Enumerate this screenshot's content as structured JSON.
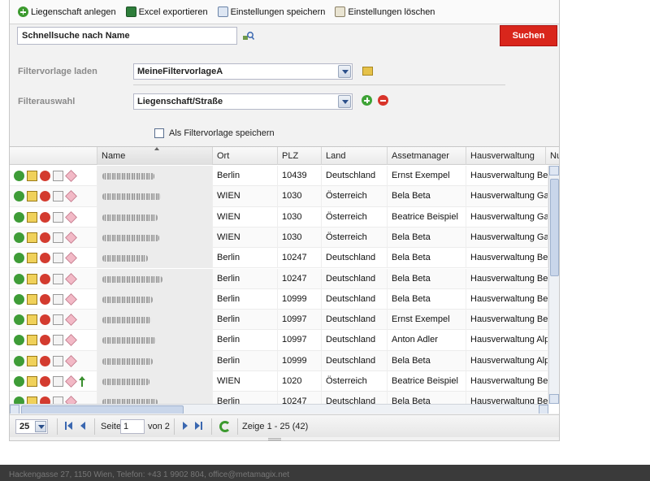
{
  "toolbar": {
    "add_label": "Liegenschaft anlegen",
    "excel_label": "Excel exportieren",
    "save_label": "Einstellungen speichern",
    "delete_label": "Einstellungen löschen"
  },
  "search": {
    "value": "Schnellsuche nach Name",
    "button_label": "Suchen"
  },
  "filter": {
    "template_label": "Filtervorlage laden",
    "template_value": "MeineFiltervorlageA",
    "selection_label": "Filterauswahl",
    "selection_value": "Liegenschaft/Straße",
    "save_checkbox_label": "Als Filtervorlage speichern"
  },
  "grid": {
    "columns": [
      "Name",
      "Ort",
      "PLZ",
      "Land",
      "Assetmanager",
      "Hausverwaltung",
      "Nu"
    ],
    "rows": [
      {
        "ort": "Berlin",
        "plz": "10439",
        "land": "Deutschland",
        "am": "Ernst Exempel",
        "hv": "Hausverwaltung Beta"
      },
      {
        "ort": "WIEN",
        "plz": "1030",
        "land": "Österreich",
        "am": "Bela Beta",
        "hv": "Hausverwaltung Gam"
      },
      {
        "ort": "WIEN",
        "plz": "1030",
        "land": "Österreich",
        "am": "Beatrice Beispiel",
        "hv": "Hausverwaltung Gam"
      },
      {
        "ort": "WIEN",
        "plz": "1030",
        "land": "Österreich",
        "am": "Bela Beta",
        "hv": "Hausverwaltung Gam"
      },
      {
        "ort": "Berlin",
        "plz": "10247",
        "land": "Deutschland",
        "am": "Bela Beta",
        "hv": "Hausverwaltung Beta"
      },
      {
        "ort": "Berlin",
        "plz": "10247",
        "land": "Deutschland",
        "am": "Bela Beta",
        "hv": "Hausverwaltung Beta"
      },
      {
        "ort": "Berlin",
        "plz": "10999",
        "land": "Deutschland",
        "am": "Bela Beta",
        "hv": "Hausverwaltung Beta"
      },
      {
        "ort": "Berlin",
        "plz": "10997",
        "land": "Deutschland",
        "am": "Ernst Exempel",
        "hv": "Hausverwaltung Beta"
      },
      {
        "ort": "Berlin",
        "plz": "10997",
        "land": "Deutschland",
        "am": "Anton Adler",
        "hv": "Hausverwaltung Alph"
      },
      {
        "ort": "Berlin",
        "plz": "10999",
        "land": "Deutschland",
        "am": "Bela Beta",
        "hv": "Hausverwaltung Alph"
      },
      {
        "ort": "WIEN",
        "plz": "1020",
        "land": "Österreich",
        "am": "Beatrice Beispiel",
        "hv": "Hausverwaltung Beta"
      },
      {
        "ort": "Berlin",
        "plz": "10247",
        "land": "Deutschland",
        "am": "Bela Beta",
        "hv": "Hausverwaltung Beta"
      }
    ]
  },
  "pager": {
    "page_size": "25",
    "page_label": "Seite",
    "page_value": "1",
    "of_label": "von 2",
    "summary": "Zeige 1 - 25 (42)"
  },
  "footer": {
    "text": "Hackengasse 27, 1150 Wien, Telefon: +43 1 9902 804, office@metamagix.net"
  },
  "colors": {
    "accent_red": "#d9261c",
    "footer_bg": "#3a3a3a"
  }
}
